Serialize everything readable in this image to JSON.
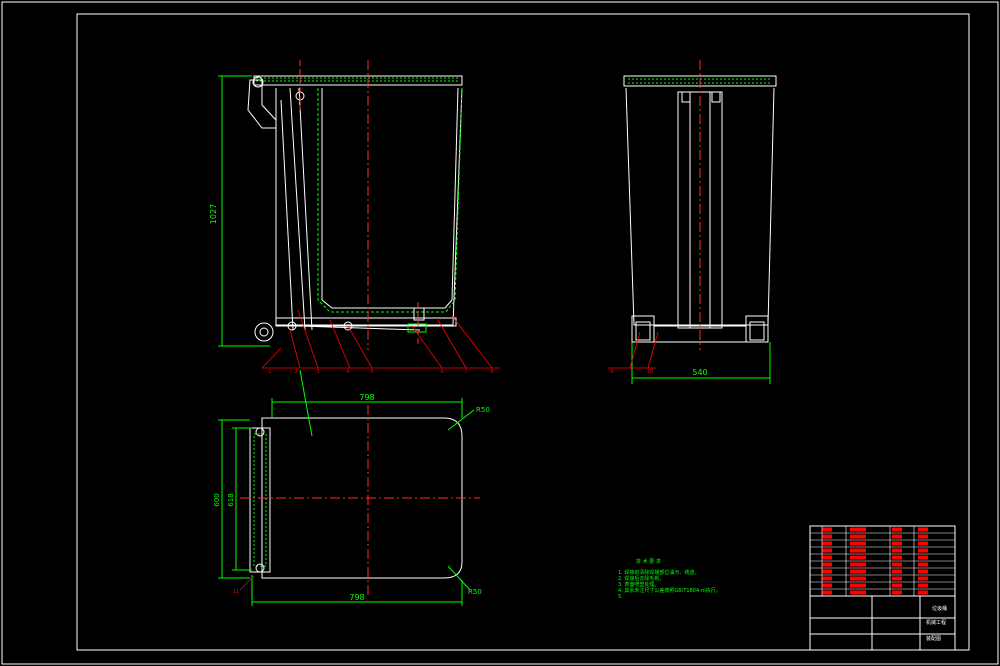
{
  "colors": {
    "background": "#000000",
    "outline": "#ffffff",
    "dimension": "#00ff00",
    "centerline": "#ff2a2a",
    "hatch": "#00ff00",
    "annotation": "#00ff00",
    "table_red": "#ff0000",
    "leader": "#ff0000"
  },
  "dimensions": {
    "front_height": "1027",
    "side_width": "540",
    "top_width_upper": "798",
    "top_width_lower": "798",
    "top_depth_outer": "600",
    "top_depth_inner": "618",
    "radius_top": "R50",
    "radius_bottom": "R50"
  },
  "balloons": [
    "1",
    "2",
    "3",
    "4",
    "5",
    "6",
    "7",
    "8",
    "9",
    "10",
    "11",
    "12"
  ],
  "tech_notes": {
    "heading": "技 术 要 求",
    "items": [
      "1. 焊接前清除焊接部位油污、锈迹。",
      "2. 焊接后去除毛刺。",
      "3. 表面喷塑处理。",
      "4. 其余未注尺寸公差按照GB/T1804-m执行。",
      "5."
    ]
  },
  "title_block": {
    "drawing_name": "垃圾桶",
    "school": "机械工程",
    "drawing_no": "装配图"
  }
}
